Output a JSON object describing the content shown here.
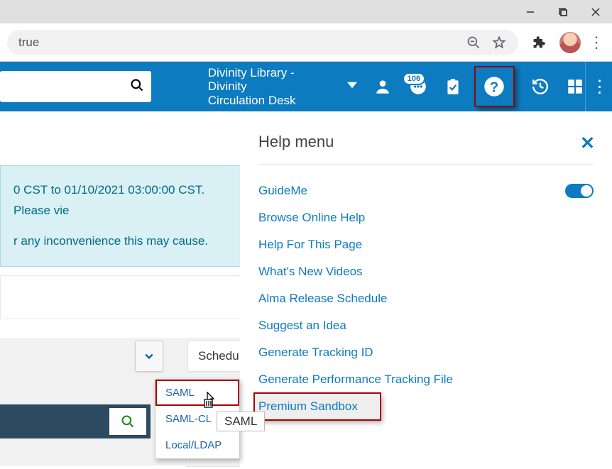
{
  "browser": {
    "address_fragment": "true"
  },
  "appbar": {
    "location_line1": "Divinity Library - Divinity",
    "location_line2": "Circulation Desk",
    "notification_count": "106"
  },
  "notification": {
    "line1": "0 CST to 01/10/2021 03:00:00 CST. Please vie",
    "line2": "r any inconvenience this may cause."
  },
  "schedule_label": "Schedu",
  "dropdown": {
    "items": [
      "SAML",
      "SAML-CL",
      "Local/LDAP"
    ],
    "tooltip": "SAML"
  },
  "help": {
    "title": "Help menu",
    "items": [
      "GuideMe",
      "Browse Online Help",
      "Help For This Page",
      "What's New Videos",
      "Alma Release Schedule",
      "Suggest an Idea",
      "Generate Tracking ID",
      "Generate Performance Tracking File",
      "Premium Sandbox"
    ],
    "guideme_on": true
  }
}
